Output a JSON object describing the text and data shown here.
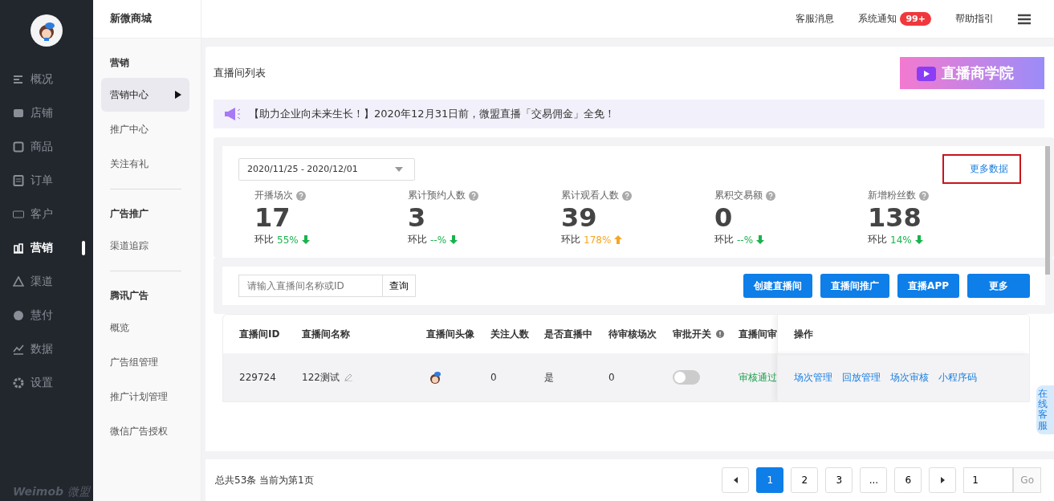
{
  "logo": {
    "latin": "Weimob",
    "cn": "微盟"
  },
  "nav": [
    {
      "label": "概况",
      "selected": false
    },
    {
      "label": "店铺",
      "selected": false
    },
    {
      "label": "商品",
      "selected": false
    },
    {
      "label": "订单",
      "selected": false
    },
    {
      "label": "客户",
      "selected": false
    },
    {
      "label": "营销",
      "selected": true
    },
    {
      "label": "渠道",
      "selected": false
    },
    {
      "label": "慧付",
      "selected": false
    },
    {
      "label": "数据",
      "selected": false
    },
    {
      "label": "设置",
      "selected": false
    }
  ],
  "shop_name": "新微商城",
  "submenu": [
    {
      "title": "营销",
      "items": [
        {
          "label": "营销中心",
          "selected": true
        },
        {
          "label": "推广中心",
          "selected": false
        },
        {
          "label": "关注有礼",
          "selected": false
        }
      ]
    },
    {
      "title": "广告推广",
      "items": [
        {
          "label": "渠道追踪",
          "selected": false
        }
      ]
    },
    {
      "title": "腾讯广告",
      "items": [
        {
          "label": "概览",
          "selected": false
        },
        {
          "label": "广告组管理",
          "selected": false
        },
        {
          "label": "推广计划管理",
          "selected": false
        },
        {
          "label": "微信广告授权",
          "selected": false
        }
      ]
    }
  ],
  "header_links": [
    {
      "label": "客服消息"
    },
    {
      "label": "系统通知",
      "badge": "99+"
    },
    {
      "label": "帮助指引"
    }
  ],
  "page_title": "直播间列表",
  "banner": "直播商学院",
  "notice": "【助力企业向未来生长！】2020年12月31日前，微盟直播「交易佣金」全免！",
  "date_range": "2020/11/25 - 2020/12/01",
  "more_data": "更多数据",
  "stats": [
    {
      "label": "开播场次",
      "value": "17",
      "ratio_label": "环比",
      "ratio": "55%",
      "rising": false
    },
    {
      "label": "累计预约人数",
      "value": "3",
      "ratio_label": "环比",
      "ratio": "--%",
      "rising": false
    },
    {
      "label": "累计观看人数",
      "value": "39",
      "ratio_label": "环比",
      "ratio": "178%",
      "rising": true
    },
    {
      "label": "累积交易额",
      "value": "0",
      "ratio_label": "环比",
      "ratio": "--%",
      "rising": false
    },
    {
      "label": "新增粉丝数",
      "value": "138",
      "ratio_label": "环比",
      "ratio": "14%",
      "rising": false
    }
  ],
  "search": {
    "placeholder": "请输入直播间名称或ID",
    "button": "查询"
  },
  "actions": [
    "创建直播间",
    "直播间推广",
    "直播APP",
    "更多"
  ],
  "table": {
    "columns": [
      "直播间ID",
      "直播间名称",
      "直播间头像",
      "关注人数",
      "是否直播中",
      "待审核场次",
      "审批开关",
      "直播间审"
    ],
    "action_column": "操作",
    "rows": [
      {
        "id": "229724",
        "name": "122测试",
        "followers": "0",
        "live": "是",
        "pending": "0",
        "approval_on": false,
        "status": "审核通过",
        "actions": [
          "场次管理",
          "回放管理",
          "场次审核",
          "小程序码"
        ]
      }
    ]
  },
  "pagination": {
    "summary": "总共53条 当前为第1页",
    "pages": [
      {
        "label": "1",
        "selected": true
      },
      {
        "label": "2",
        "selected": false
      },
      {
        "label": "3",
        "selected": false
      },
      {
        "label": "...",
        "selected": false
      },
      {
        "label": "6",
        "selected": false
      }
    ],
    "jump_value": "1",
    "go": "Go"
  },
  "support_tab": "在线客服"
}
